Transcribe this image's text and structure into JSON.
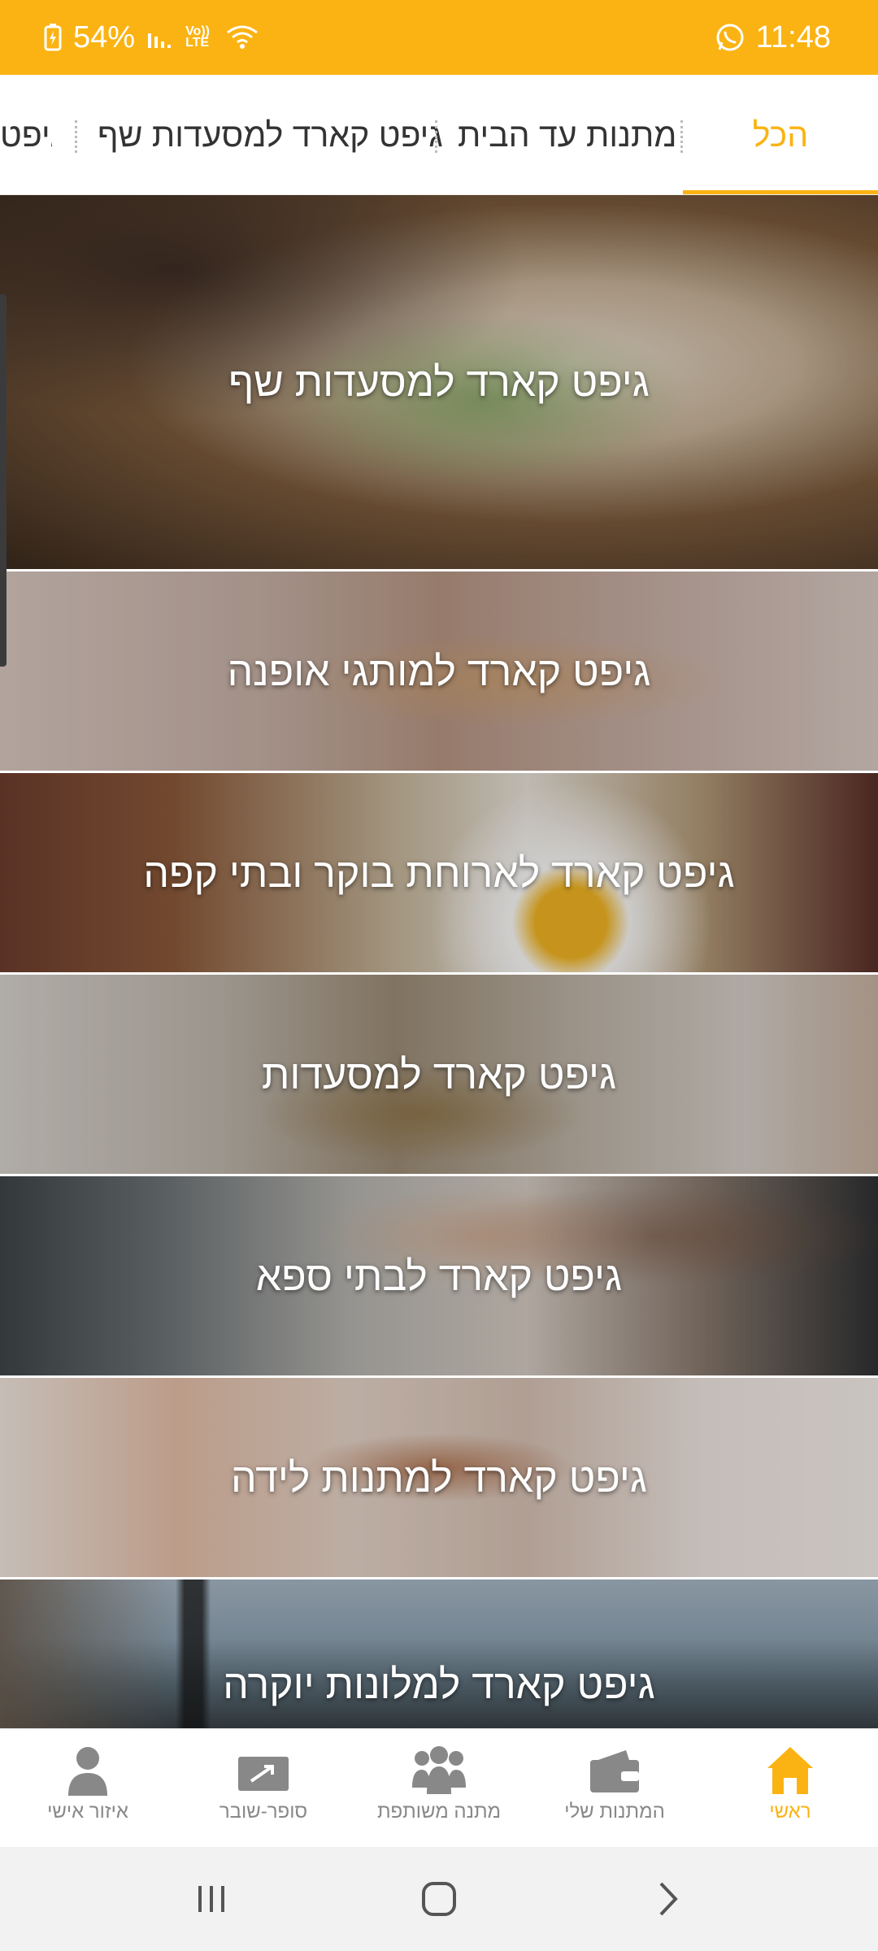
{
  "status_bar": {
    "battery": "54%",
    "volte": "Vo)) LTE",
    "time": "11:48"
  },
  "tabs": [
    {
      "label": "הכל",
      "active": true
    },
    {
      "label": "מתנות עד הבית",
      "active": false
    },
    {
      "label": "גיפט קארד למסעדות שף",
      "active": false
    },
    {
      "label": "גיפט",
      "active": false
    }
  ],
  "cards": [
    {
      "title": "גיפט קארד למסעדות שף"
    },
    {
      "title": "גיפט קארד למותגי אופנה"
    },
    {
      "title": "גיפט קארד לארוחת בוקר ובתי קפה"
    },
    {
      "title": "גיפט קארד למסעדות"
    },
    {
      "title": "גיפט קארד לבתי ספא"
    },
    {
      "title": "גיפט קארד למתנות לידה"
    },
    {
      "title": "גיפט קארד למלונות יוקרה"
    }
  ],
  "bottom_nav": [
    {
      "label": "ראשי",
      "icon": "home-icon",
      "active": true
    },
    {
      "label": "המתנות שלי",
      "icon": "wallet-icon",
      "active": false
    },
    {
      "label": "מתנה משותפת",
      "icon": "group-icon",
      "active": false
    },
    {
      "label": "סופר-שובר",
      "icon": "voucher-icon",
      "active": false
    },
    {
      "label": "איזור אישי",
      "icon": "person-icon",
      "active": false
    }
  ],
  "colors": {
    "accent": "#fbb313",
    "inactive": "#888888"
  }
}
